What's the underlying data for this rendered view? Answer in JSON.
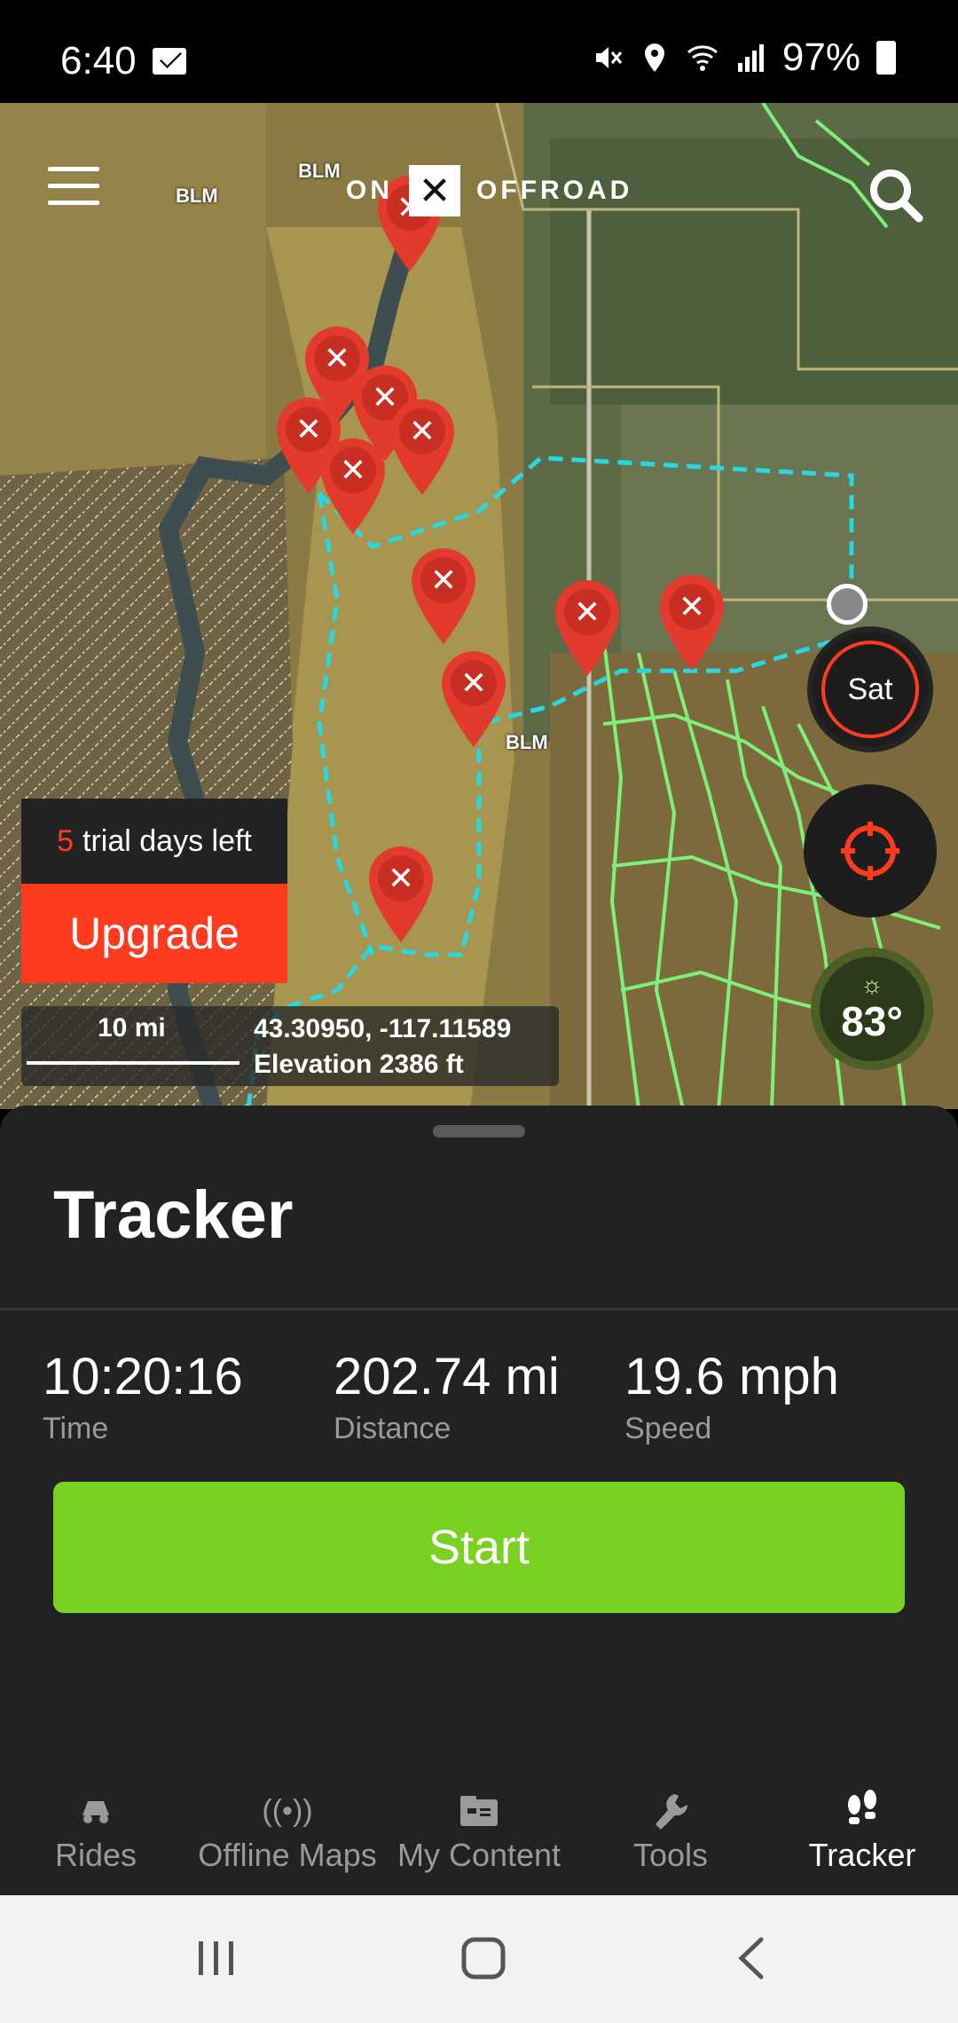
{
  "status_bar": {
    "time": "6:40",
    "battery": "97%",
    "icons": [
      "mail-icon",
      "mute-icon",
      "location-icon",
      "wifi-icon",
      "signal-icon",
      "battery-icon"
    ]
  },
  "map": {
    "logo_left": "ON",
    "logo_mark": "✕",
    "logo_right": "OFFROAD",
    "labels": [
      "BLM",
      "BLM",
      "BLM"
    ],
    "sat_label": "Sat",
    "temperature": "83°",
    "trial": {
      "count": "5",
      "text": "trial days left"
    },
    "upgrade_label": "Upgrade",
    "scale": "10 mi",
    "coordinates": "43.30950, -117.11589",
    "elevation": "Elevation 2386 ft"
  },
  "tracker": {
    "title": "Tracker",
    "stats": [
      {
        "value": "10:20:16",
        "label": "Time"
      },
      {
        "value": "202.74 mi",
        "label": "Distance"
      },
      {
        "value": "19.6 mph",
        "label": "Speed"
      }
    ],
    "start_label": "Start"
  },
  "tabs": [
    {
      "label": "Rides",
      "icon": "rides-icon"
    },
    {
      "label": "Offline Maps",
      "icon": "offline-maps-icon"
    },
    {
      "label": "My Content",
      "icon": "my-content-icon"
    },
    {
      "label": "Tools",
      "icon": "tools-icon"
    },
    {
      "label": "Tracker",
      "icon": "tracker-icon",
      "active": true
    }
  ],
  "colors": {
    "accent": "#ff3b1f",
    "start_green": "#79d121",
    "route_cyan": "#27d8e0",
    "trail_green": "#7ef07a"
  }
}
